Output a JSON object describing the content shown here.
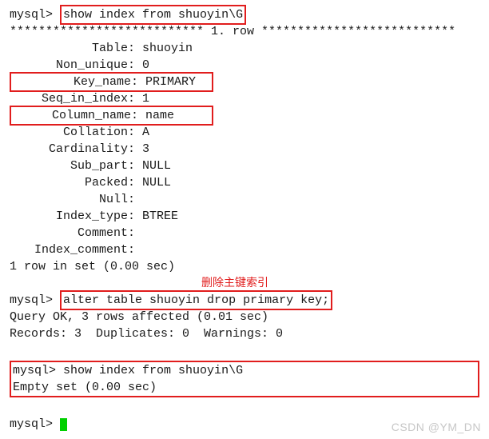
{
  "prompt": "mysql>",
  "cmd1": "show index from shuoyin\\G",
  "row_header": "*************************** 1. row ***************************",
  "kv": {
    "table_label": "Table",
    "table_val": "shuoyin",
    "nonunique_label": "Non_unique",
    "nonunique_val": "0",
    "keyname_label": "Key_name",
    "keyname_val": "PRIMARY",
    "seqinidx_label": "Seq_in_index",
    "seqinidx_val": "1",
    "colname_label": "Column_name",
    "colname_val": "name",
    "collation_label": "Collation",
    "collation_val": "A",
    "cardinality_label": "Cardinality",
    "cardinality_val": "3",
    "subpart_label": "Sub_part",
    "subpart_val": "NULL",
    "packed_label": "Packed",
    "packed_val": "NULL",
    "null_label": "Null",
    "null_val": "",
    "idxtype_label": "Index_type",
    "idxtype_val": "BTREE",
    "comment_label": "Comment",
    "comment_val": "",
    "idxcomment_label": "Index_comment",
    "idxcomment_val": ""
  },
  "result1": "1 row in set (0.00 sec)",
  "annotation": "删除主键索引",
  "cmd2": "alter table shuoyin drop primary key;",
  "result2a": "Query OK, 3 rows affected (0.01 sec)",
  "result2b": "Records: 3  Duplicates: 0  Warnings: 0",
  "cmd3": "show index from shuoyin\\G",
  "result3": "Empty set (0.00 sec)",
  "watermark": "CSDN @YM_DN"
}
